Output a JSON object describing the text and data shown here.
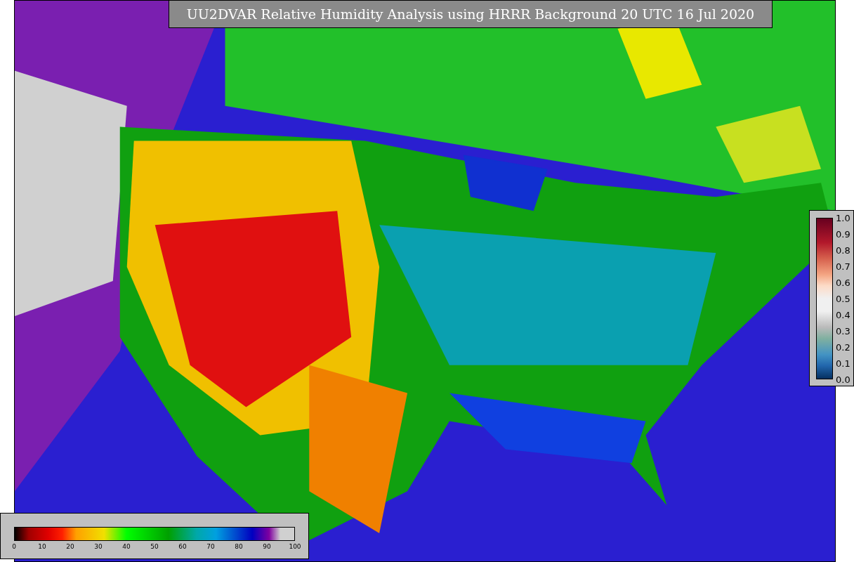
{
  "title": "UU2DVAR Relative Humidity Analysis using HRRR Background 20 UTC 16 Jul 2020",
  "humidity_colorbar": {
    "ticks": [
      "0",
      "10",
      "20",
      "30",
      "40",
      "50",
      "60",
      "70",
      "80",
      "90",
      "100"
    ]
  },
  "weight_colorbar": {
    "ticks": [
      "1.0",
      "0.9",
      "0.8",
      "0.7",
      "0.6",
      "0.5",
      "0.4",
      "0.3",
      "0.2",
      "0.1",
      "0.0"
    ]
  }
}
